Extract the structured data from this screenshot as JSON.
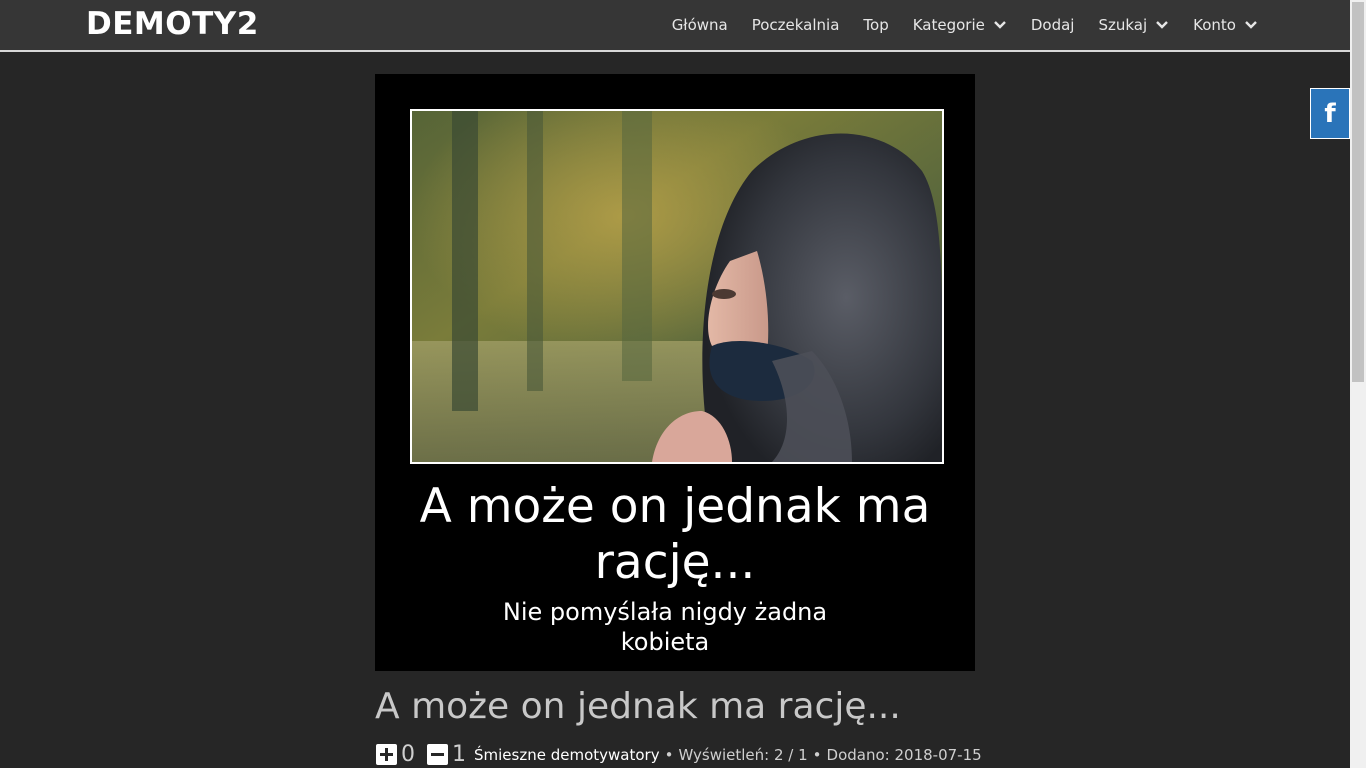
{
  "header": {
    "logo": "DEMOTY2",
    "nav": [
      {
        "label": "Główna",
        "has_dropdown": false
      },
      {
        "label": "Poczekalnia",
        "has_dropdown": false
      },
      {
        "label": "Top",
        "has_dropdown": false
      },
      {
        "label": "Kategorie",
        "has_dropdown": true
      },
      {
        "label": "Dodaj",
        "has_dropdown": false
      },
      {
        "label": "Szukaj",
        "has_dropdown": true
      },
      {
        "label": "Konto",
        "has_dropdown": true
      }
    ]
  },
  "facebook_tab": {
    "label": "f",
    "color": "#2a74b9"
  },
  "poster": {
    "title": "A może on jednak ma rację...",
    "subtitle": "Nie pomyślała nigdy żadna kobieta"
  },
  "post": {
    "title": "A może on jednak ma rację...",
    "upvotes": "0",
    "downvotes": "1",
    "category": "Śmieszne demotywatory",
    "views": "Wyświetleń: 2 / 1",
    "added": "Dodano: 2018-07-15",
    "separator": "•"
  },
  "colors": {
    "background": "#262626",
    "header": "#363636",
    "poster_bg": "#000000",
    "accent": "#2a74b9"
  }
}
